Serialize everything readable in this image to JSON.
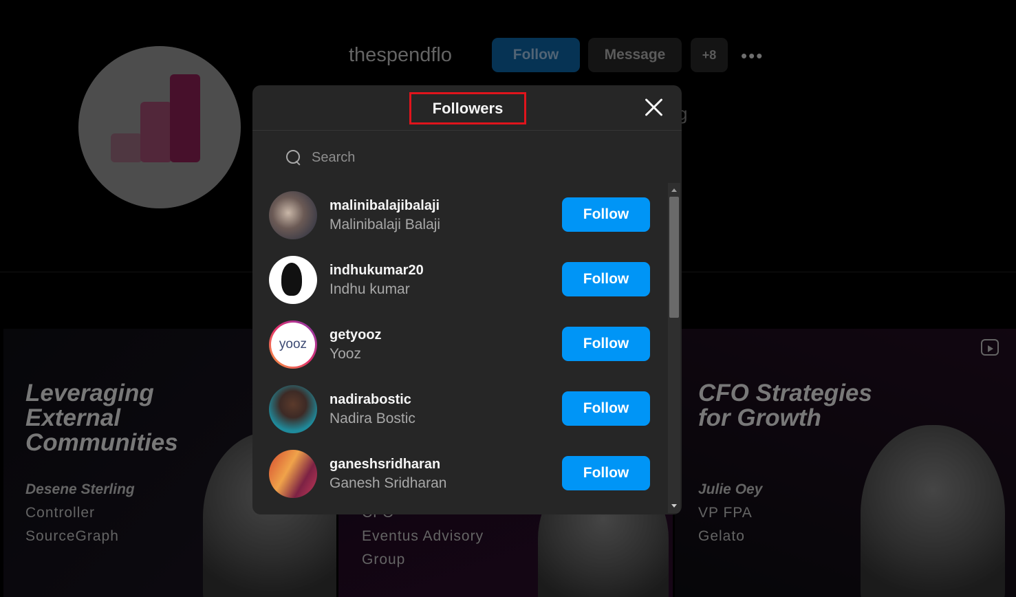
{
  "profile": {
    "username": "thespendflo",
    "follow_label": "Follow",
    "message_label": "Message",
    "add_user_label": "+8",
    "more_label": "•••",
    "stray_text": "g"
  },
  "posts": [
    {
      "title_lines": [
        "Leveraging",
        "External",
        "Communities"
      ],
      "speaker": "Desene Sterling",
      "role": "Controller",
      "company": "SourceGraph"
    },
    {
      "role": "CFO",
      "company_lines": [
        "Eventus Advisory",
        "Group"
      ]
    },
    {
      "title_lines": [
        "CFO Strategies",
        "for Growth"
      ],
      "speaker": "Julie Oey",
      "role": "VP FPA",
      "company": "Gelato"
    }
  ],
  "modal": {
    "title": "Followers",
    "search_placeholder": "Search",
    "followers": [
      {
        "username": "malinibalajibalaji",
        "full_name": "Malinibalaji Balaji",
        "button": "Follow",
        "avatar": "photo-avatar"
      },
      {
        "username": "indhukumar20",
        "full_name": "Indhu kumar",
        "button": "Follow",
        "avatar": "strong-women-avatar"
      },
      {
        "username": "getyooz",
        "full_name": "Yooz",
        "button": "Follow",
        "avatar": "yooz-logo-avatar",
        "avatar_text": "yooz"
      },
      {
        "username": "nadirabostic",
        "full_name": "Nadira Bostic",
        "button": "Follow",
        "avatar": "photo-avatar"
      },
      {
        "username": "ganeshsridharan",
        "full_name": "Ganesh Sridharan",
        "button": "Follow",
        "avatar": "photo-avatar"
      }
    ]
  },
  "colors": {
    "follow_button": "#0095f6",
    "modal_bg": "#262626",
    "highlight_box": "#e0141c"
  }
}
